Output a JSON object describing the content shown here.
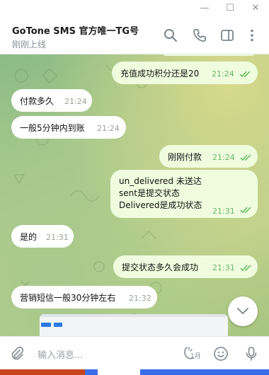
{
  "window": {
    "minimize_glyph": "—",
    "maximize_glyph": "☐",
    "close_glyph": "✕"
  },
  "header": {
    "title": "GoTone SMS 官方唯一TG号",
    "status": "刚刚上线",
    "icons": [
      "search-icon",
      "phone-icon",
      "sidebar-toggle-icon",
      "more-vertical-icon"
    ]
  },
  "messages": [
    {
      "direction": "out",
      "text": "充值成功积分还是20",
      "time": "21:24",
      "read": true
    },
    {
      "direction": "in",
      "text": "付款多久",
      "time": "21:24"
    },
    {
      "direction": "in",
      "text": "一般5分钟内到账",
      "time": "21:24"
    },
    {
      "direction": "out",
      "text": "刚刚付款",
      "time": "21:24",
      "read": true
    },
    {
      "direction": "out",
      "lines": [
        "un_delivered 未送达",
        "sent是提交状态",
        "Delivered是成功状态"
      ],
      "time": "21:31",
      "read": true
    },
    {
      "direction": "in",
      "text": "是的",
      "time": "21:31"
    },
    {
      "direction": "out",
      "text": "提交状态多久会成功",
      "time": "21:31",
      "read": true
    },
    {
      "direction": "in",
      "text": "营销短信一般30分钟左右",
      "time": "21:32"
    }
  ],
  "composer": {
    "placeholder": "输入消息...",
    "emoji_status_label": "1月",
    "icons": [
      "attach-icon",
      "moon-timer-icon",
      "emoji-icon",
      "microphone-icon"
    ]
  },
  "colors": {
    "accent": "#3a9cd8",
    "outgoing_bubble": "#effdde",
    "incoming_bubble": "#ffffff",
    "read_check": "#5fb75b"
  }
}
